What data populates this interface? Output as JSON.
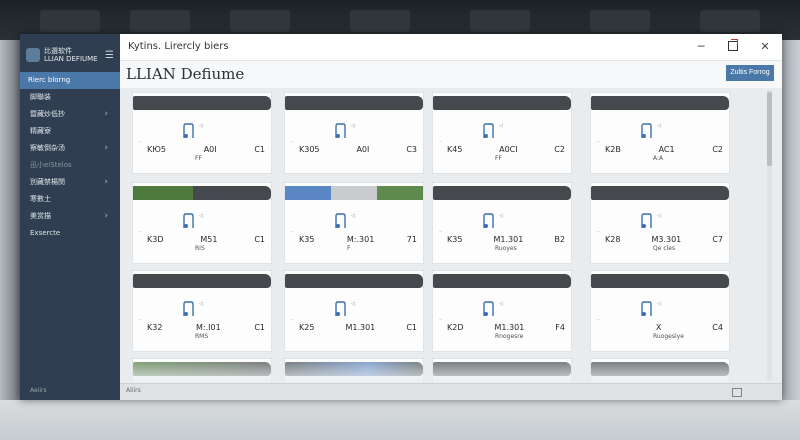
{
  "sidebar": {
    "brand_line1": "比選软件",
    "brand_line2": "LLIAN DEFIUME",
    "items": [
      {
        "label": "Rierc blorng",
        "active": true
      },
      {
        "label": "脚聯装"
      },
      {
        "label": "暨藏炒低抄",
        "chevron": true
      },
      {
        "label": "精藏寮"
      },
      {
        "label": "察敏倒杂汤",
        "chevron": true
      },
      {
        "label": "迅小eiStelos",
        "muted": true
      },
      {
        "label": "別藏禁楊閔",
        "chevron": true
      },
      {
        "label": "寒數土"
      },
      {
        "label": "美赏描",
        "chevron": true
      },
      {
        "label": "Exsercte"
      }
    ],
    "footer": "Aeiirs"
  },
  "window": {
    "title": "Kytins. Lirercly biers",
    "heading": "LLIAN Defiume",
    "primary_button": "Zultis Forrog",
    "status_text": "Aliirs"
  },
  "cards": [
    {
      "a": "KЮ5",
      "b": "A0I",
      "c": "C1",
      "sub": "FF",
      "colors": []
    },
    {
      "a": "K305",
      "b": "A0I",
      "c": "C3",
      "sub": "",
      "colors": []
    },
    {
      "a": "K45",
      "b": "A0CI",
      "c": "C2",
      "sub": "FF",
      "colors": []
    },
    {
      "a": "K2B",
      "b": "AC1",
      "c": "C2",
      "sub": "A:A",
      "colors": []
    },
    {
      "a": "K3D",
      "b": "M51",
      "c": "C1",
      "sub": "RIS",
      "colors": [
        "#4f7a3e"
      ]
    },
    {
      "a": "K35",
      "b": "M:.301",
      "c": "71",
      "sub": "F",
      "colors": [
        "#5b86c4",
        "#c9ccce",
        "#5f8a4e"
      ]
    },
    {
      "a": "K35",
      "b": "M1.301",
      "c": "B2",
      "sub": "Ruoyes",
      "colors": []
    },
    {
      "a": "K28",
      "b": "M3.301",
      "c": "C7",
      "sub": "Qe cles",
      "colors": []
    },
    {
      "a": "K32",
      "b": "M:.I01",
      "c": "C1",
      "sub": "RMS",
      "colors": []
    },
    {
      "a": "K25",
      "b": "M1.301",
      "c": "C1",
      "sub": "",
      "colors": []
    },
    {
      "a": "K2D",
      "b": "M1.301",
      "c": "F4",
      "sub": "Rnogesre",
      "colors": []
    },
    {
      "a": "",
      "b": "X",
      "c": "C4",
      "sub": "Ruogesiye",
      "colors": []
    }
  ]
}
